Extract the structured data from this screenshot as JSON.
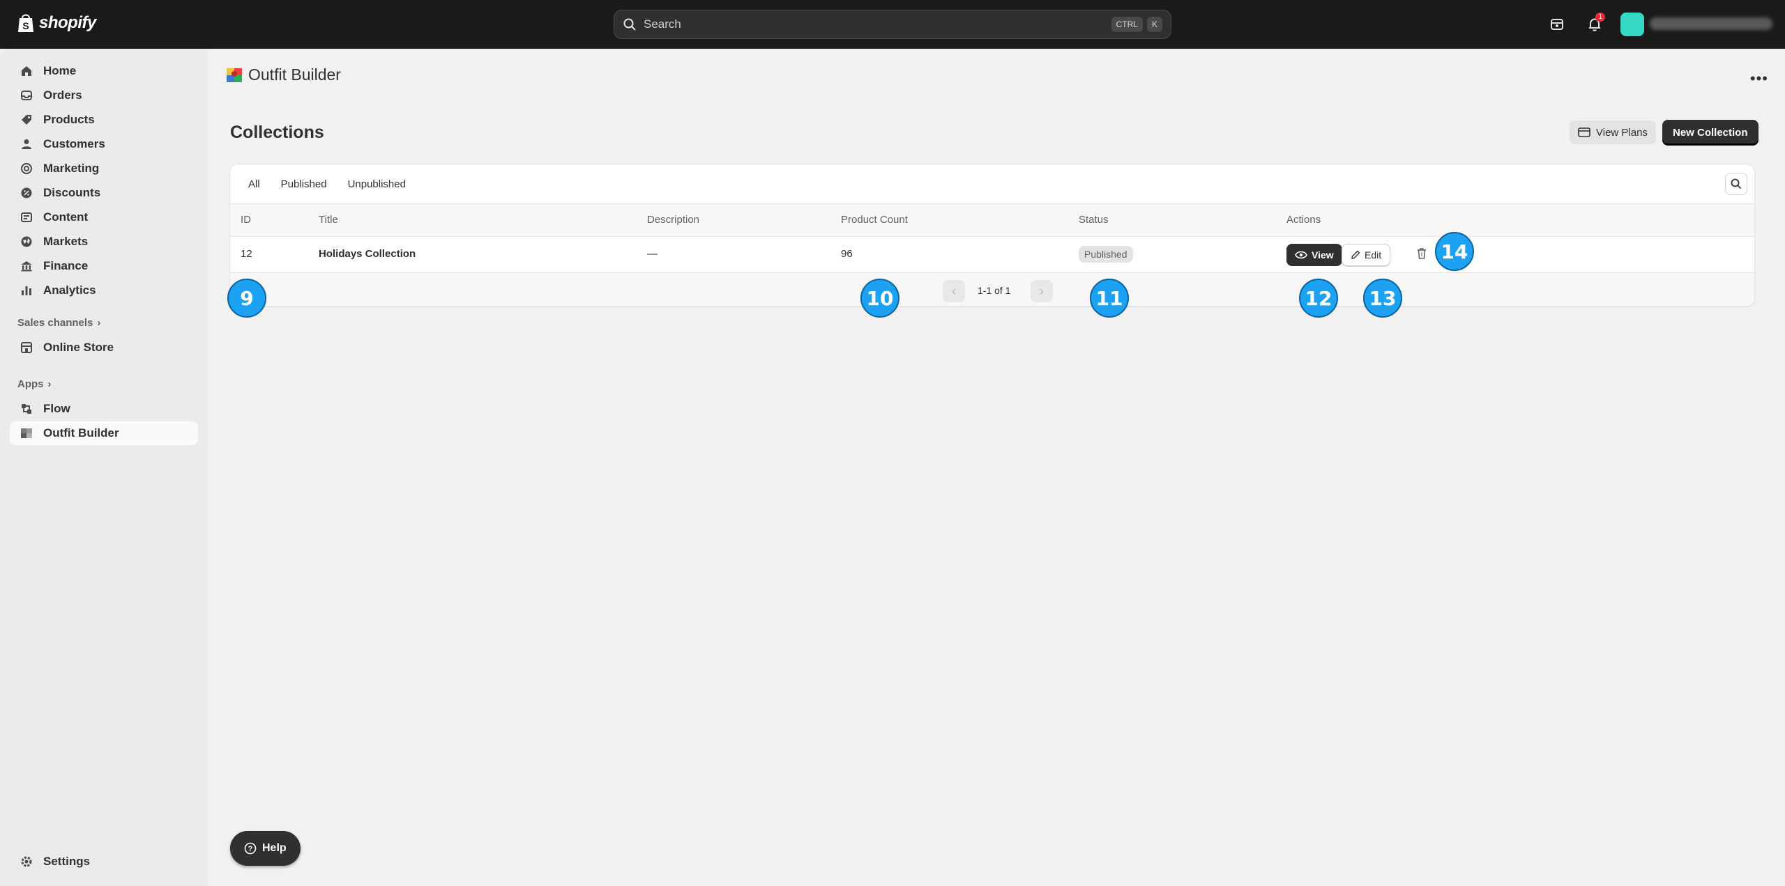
{
  "topbar": {
    "logo_text": "shopify",
    "search_placeholder": "Search",
    "shortcut_keys": [
      "CTRL",
      "K"
    ],
    "notification_count": "1",
    "store_name": "simple not basic theme"
  },
  "sidebar": {
    "items": [
      {
        "label": "Home",
        "icon": "home-icon"
      },
      {
        "label": "Orders",
        "icon": "inbox-icon"
      },
      {
        "label": "Products",
        "icon": "tag-icon"
      },
      {
        "label": "Customers",
        "icon": "person-icon"
      },
      {
        "label": "Marketing",
        "icon": "target-icon"
      },
      {
        "label": "Discounts",
        "icon": "discount-icon"
      },
      {
        "label": "Content",
        "icon": "content-icon"
      },
      {
        "label": "Markets",
        "icon": "globe-icon"
      },
      {
        "label": "Finance",
        "icon": "bank-icon"
      },
      {
        "label": "Analytics",
        "icon": "bar-chart-icon"
      }
    ],
    "sales_channels_label": "Sales channels",
    "online_store_label": "Online Store",
    "apps_label": "Apps",
    "apps": [
      {
        "label": "Flow"
      },
      {
        "label": "Outfit Builder"
      }
    ],
    "settings_label": "Settings"
  },
  "app_header": {
    "title": "Outfit Builder"
  },
  "page": {
    "title": "Collections",
    "view_plans_label": "View Plans",
    "new_collection_label": "New Collection"
  },
  "tabs": [
    "All",
    "Published",
    "Unpublished"
  ],
  "table": {
    "columns": [
      "ID",
      "Title",
      "Description",
      "Product Count",
      "Status",
      "Actions"
    ],
    "rows": [
      {
        "id": "12",
        "title": "Holidays Collection",
        "description": "—",
        "product_count": "96",
        "status": "Published"
      }
    ],
    "view_label": "View",
    "edit_label": "Edit",
    "pagination_text": "1-1 of 1"
  },
  "markers": [
    "9",
    "10",
    "11",
    "12",
    "13",
    "14"
  ],
  "help_label": "Help",
  "colors": {
    "topbar": "#1a1a1a",
    "primary_button": "#303030",
    "marker": "#1da1f2",
    "notification_badge": "#e22c38",
    "avatar": "#36d7c5"
  }
}
